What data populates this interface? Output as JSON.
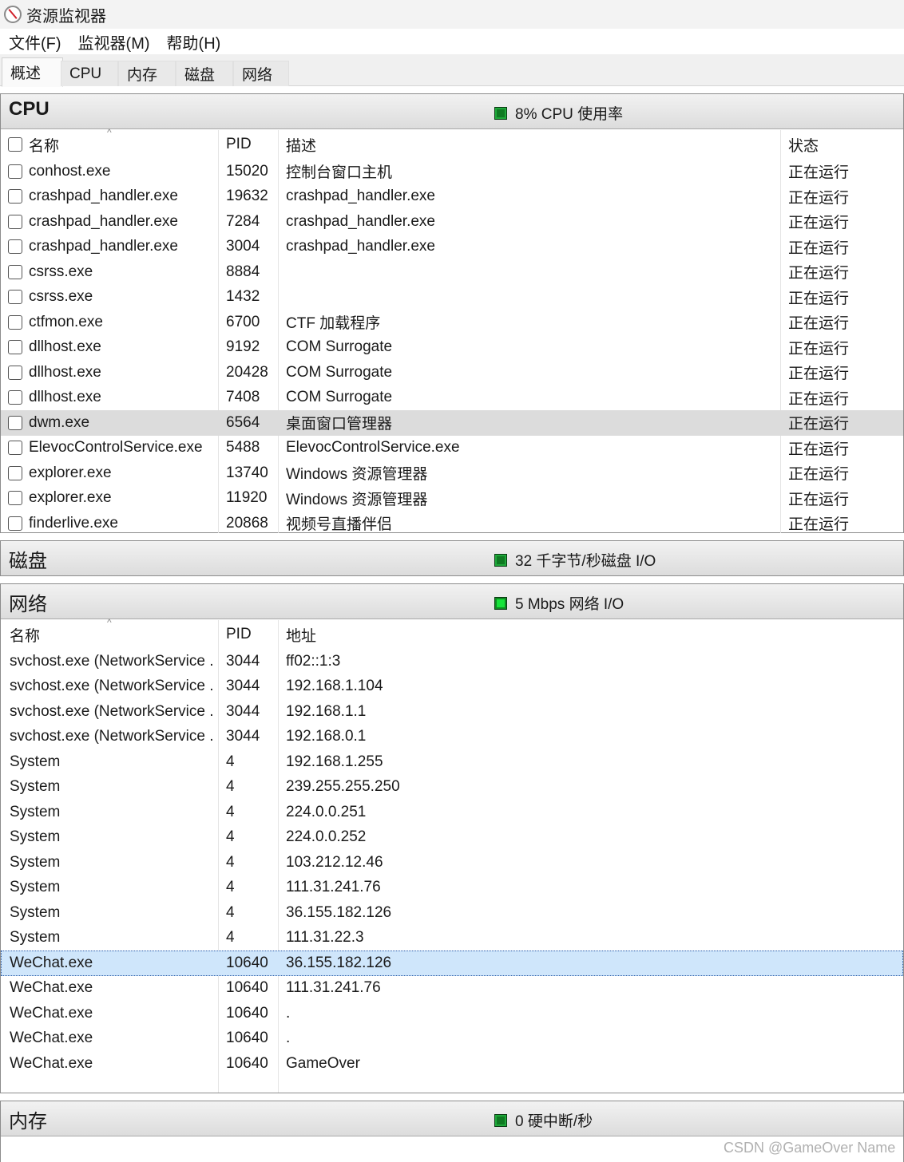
{
  "window": {
    "title": "资源监视器"
  },
  "menu": [
    "文件(F)",
    "监视器(M)",
    "帮助(H)"
  ],
  "tabs": [
    "概述",
    "CPU",
    "内存",
    "磁盘",
    "网络"
  ],
  "cpu_panel": {
    "title": "CPU",
    "stat": "8% CPU 使用率",
    "columns": [
      "名称",
      "PID",
      "描述",
      "状态"
    ],
    "rows": [
      [
        "conhost.exe",
        "15020",
        "控制台窗口主机",
        "正在运行"
      ],
      [
        "crashpad_handler.exe",
        "19632",
        "crashpad_handler.exe",
        "正在运行"
      ],
      [
        "crashpad_handler.exe",
        "7284",
        "crashpad_handler.exe",
        "正在运行"
      ],
      [
        "crashpad_handler.exe",
        "3004",
        "crashpad_handler.exe",
        "正在运行"
      ],
      [
        "csrss.exe",
        "8884",
        "",
        "正在运行"
      ],
      [
        "csrss.exe",
        "1432",
        "",
        "正在运行"
      ],
      [
        "ctfmon.exe",
        "6700",
        "CTF 加载程序",
        "正在运行"
      ],
      [
        "dllhost.exe",
        "9192",
        "COM Surrogate",
        "正在运行"
      ],
      [
        "dllhost.exe",
        "20428",
        "COM Surrogate",
        "正在运行"
      ],
      [
        "dllhost.exe",
        "7408",
        "COM Surrogate",
        "正在运行"
      ],
      [
        "dwm.exe",
        "6564",
        "桌面窗口管理器",
        "正在运行"
      ],
      [
        "ElevocControlService.exe",
        "5488",
        "ElevocControlService.exe",
        "正在运行"
      ],
      [
        "explorer.exe",
        "13740",
        "Windows 资源管理器",
        "正在运行"
      ],
      [
        "explorer.exe",
        "11920",
        "Windows 资源管理器",
        "正在运行"
      ],
      [
        "finderlive.exe",
        "20868",
        "视频号直播伴侣",
        "正在运行"
      ]
    ]
  },
  "disk_panel": {
    "title": "磁盘",
    "stat": "32 千字节/秒磁盘 I/O"
  },
  "network_panel": {
    "title": "网络",
    "stat": "5 Mbps 网络 I/O",
    "columns": [
      "名称",
      "PID",
      "地址"
    ],
    "rows": [
      [
        "svchost.exe (NetworkService ...",
        "3044",
        "ff02::1:3"
      ],
      [
        "svchost.exe (NetworkService ...",
        "3044",
        "192.168.1.104"
      ],
      [
        "svchost.exe (NetworkService ...",
        "3044",
        "192.168.1.1"
      ],
      [
        "svchost.exe (NetworkService ...",
        "3044",
        "192.168.0.1"
      ],
      [
        "System",
        "4",
        "192.168.1.255"
      ],
      [
        "System",
        "4",
        "239.255.255.250"
      ],
      [
        "System",
        "4",
        "224.0.0.251"
      ],
      [
        "System",
        "4",
        "224.0.0.252"
      ],
      [
        "System",
        "4",
        "103.212.12.46"
      ],
      [
        "System",
        "4",
        "111.31.241.76"
      ],
      [
        "System",
        "4",
        "36.155.182.126"
      ],
      [
        "System",
        "4",
        "111.31.22.3"
      ],
      [
        "WeChat.exe",
        "10640",
        "36.155.182.126"
      ],
      [
        "WeChat.exe",
        "10640",
        "111.31.241.76"
      ],
      [
        "WeChat.exe",
        "10640",
        "."
      ],
      [
        "WeChat.exe",
        "10640",
        "."
      ],
      [
        "WeChat.exe",
        "10640",
        "GameOver"
      ]
    ]
  },
  "memory_panel": {
    "title": "内存",
    "stat": "0 硬中断/秒"
  },
  "watermark": "CSDN @GameOver Name",
  "colors": {
    "led_dark": "#0f7a22",
    "led_bright": "#16e33a",
    "highlight_row": "#dcdcdc",
    "selected_row": "#cfe6fb"
  },
  "icons": {
    "app": "resource-monitor-icon",
    "led": "activity-led-icon",
    "checkbox": "checkbox-icon"
  }
}
